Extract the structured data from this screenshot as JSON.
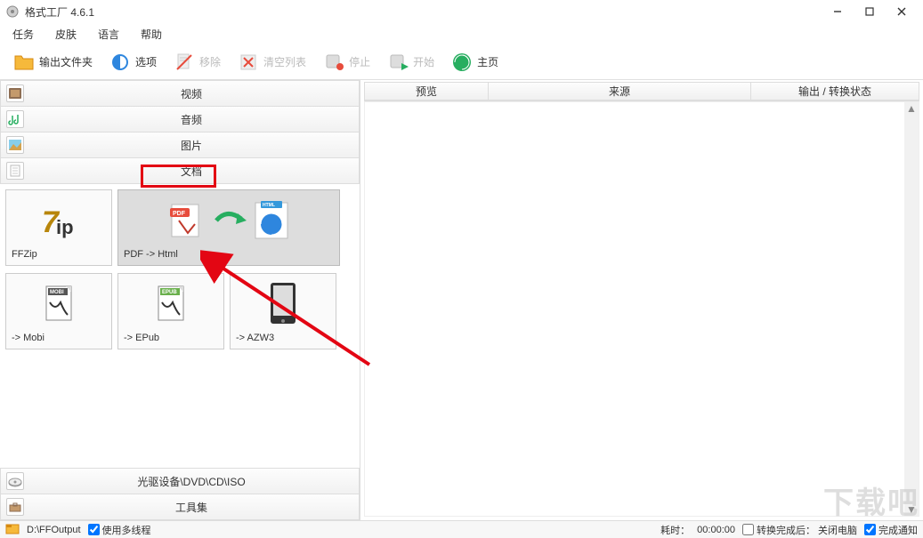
{
  "window": {
    "title": "格式工厂 4.6.1"
  },
  "menu": {
    "task": "任务",
    "skin": "皮肤",
    "language": "语言",
    "help": "帮助"
  },
  "toolbar": {
    "output_folder": "输出文件夹",
    "options": "选项",
    "remove": "移除",
    "clear_list": "清空列表",
    "stop": "停止",
    "start": "开始",
    "home": "主页"
  },
  "categories": {
    "video": "视频",
    "audio": "音频",
    "picture": "图片",
    "document": "文档",
    "optical": "光驱设备\\DVD\\CD\\ISO",
    "toolset": "工具集"
  },
  "tiles": {
    "ffzip": "FFZip",
    "pdf_html": "PDF -> Html",
    "mobi": "-> Mobi",
    "epub": "-> EPub",
    "azw3": "-> AZW3"
  },
  "table": {
    "preview": "预览",
    "source": "来源",
    "status": "输出 / 转换状态"
  },
  "status": {
    "output_path": "D:\\FFOutput",
    "multithread": "使用多线程",
    "elapsed_label": "耗时：",
    "elapsed_value": "00:00:00",
    "after_label": "转换完成后：",
    "after_value": "关闭电脑",
    "notify": "完成通知"
  },
  "watermark": "下载吧"
}
